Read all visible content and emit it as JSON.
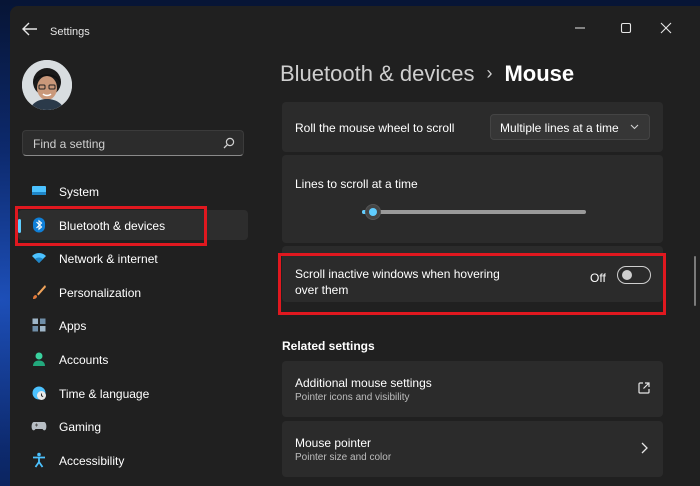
{
  "window": {
    "title": "Settings"
  },
  "search": {
    "placeholder": "Find a setting"
  },
  "sidebar": {
    "items": [
      {
        "label": "System",
        "icon": "monitor-icon"
      },
      {
        "label": "Bluetooth & devices",
        "icon": "bluetooth-icon",
        "selected": true
      },
      {
        "label": "Network & internet",
        "icon": "wifi-icon"
      },
      {
        "label": "Personalization",
        "icon": "brush-icon"
      },
      {
        "label": "Apps",
        "icon": "apps-icon"
      },
      {
        "label": "Accounts",
        "icon": "person-icon"
      },
      {
        "label": "Time & language",
        "icon": "globe-clock-icon"
      },
      {
        "label": "Gaming",
        "icon": "gamepad-icon"
      },
      {
        "label": "Accessibility",
        "icon": "accessibility-icon"
      }
    ]
  },
  "breadcrumb": {
    "parent": "Bluetooth & devices",
    "separator": "›",
    "current": "Mouse"
  },
  "settings": {
    "roll_wheel": {
      "label": "Roll the mouse wheel to scroll",
      "value": "Multiple lines at a time"
    },
    "lines_to_scroll": {
      "label": "Lines to scroll at a time",
      "level_fraction": 0.05
    },
    "scroll_inactive": {
      "label_line1": "Scroll inactive windows when hovering",
      "label_line2": "over them",
      "state": "Off"
    }
  },
  "related": {
    "heading": "Related settings",
    "items": [
      {
        "title": "Additional mouse settings",
        "subtitle": "Pointer icons and visibility",
        "icon": "open-external-icon"
      },
      {
        "title": "Mouse pointer",
        "subtitle": "Pointer size and color",
        "icon": "chevron-right-icon"
      }
    ]
  },
  "colors": {
    "accent": "#60cdff",
    "highlight": "#e0181f",
    "window_bg": "#202020",
    "card_bg": "#2b2b2b"
  }
}
